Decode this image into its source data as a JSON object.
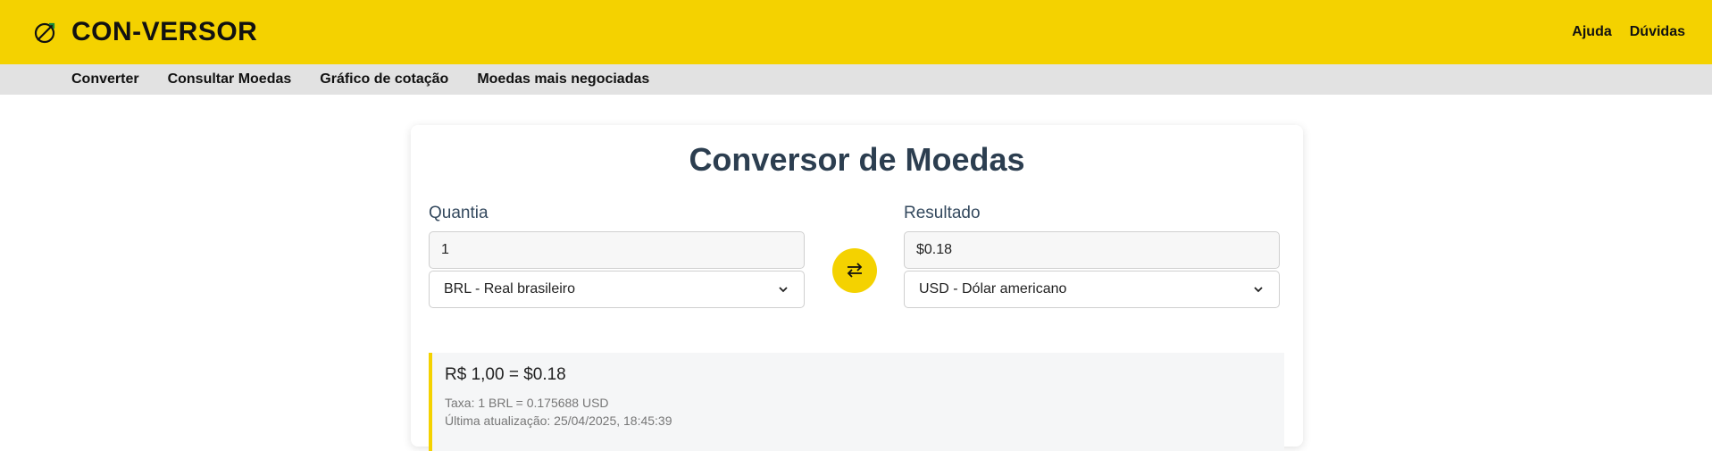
{
  "header": {
    "brand": "CON-VERSOR",
    "logo_icon": "compass-icon",
    "links": [
      "Ajuda",
      "Dúvidas"
    ]
  },
  "subnav": {
    "items": [
      "Converter",
      "Consultar Moedas",
      "Gráfico de cotação",
      "Moedas mais negociadas"
    ]
  },
  "converter": {
    "title": "Conversor de Moedas",
    "amount_label": "Quantia",
    "amount_value": "1",
    "from_currency": "BRL - Real brasileiro",
    "result_label": "Resultado",
    "result_value": "$0.18",
    "to_currency": "USD - Dólar americano",
    "swap_icon": "swap-arrows-icon"
  },
  "info": {
    "main": "R$ 1,00 = $0.18",
    "rate": "Taxa: 1 BRL = 0.175688 USD",
    "updated": "Última atualização: 25/04/2025, 18:45:39"
  },
  "colors": {
    "accent": "#f4d200",
    "subnav_bg": "#e2e2e2",
    "title_text": "#2c3e50"
  }
}
